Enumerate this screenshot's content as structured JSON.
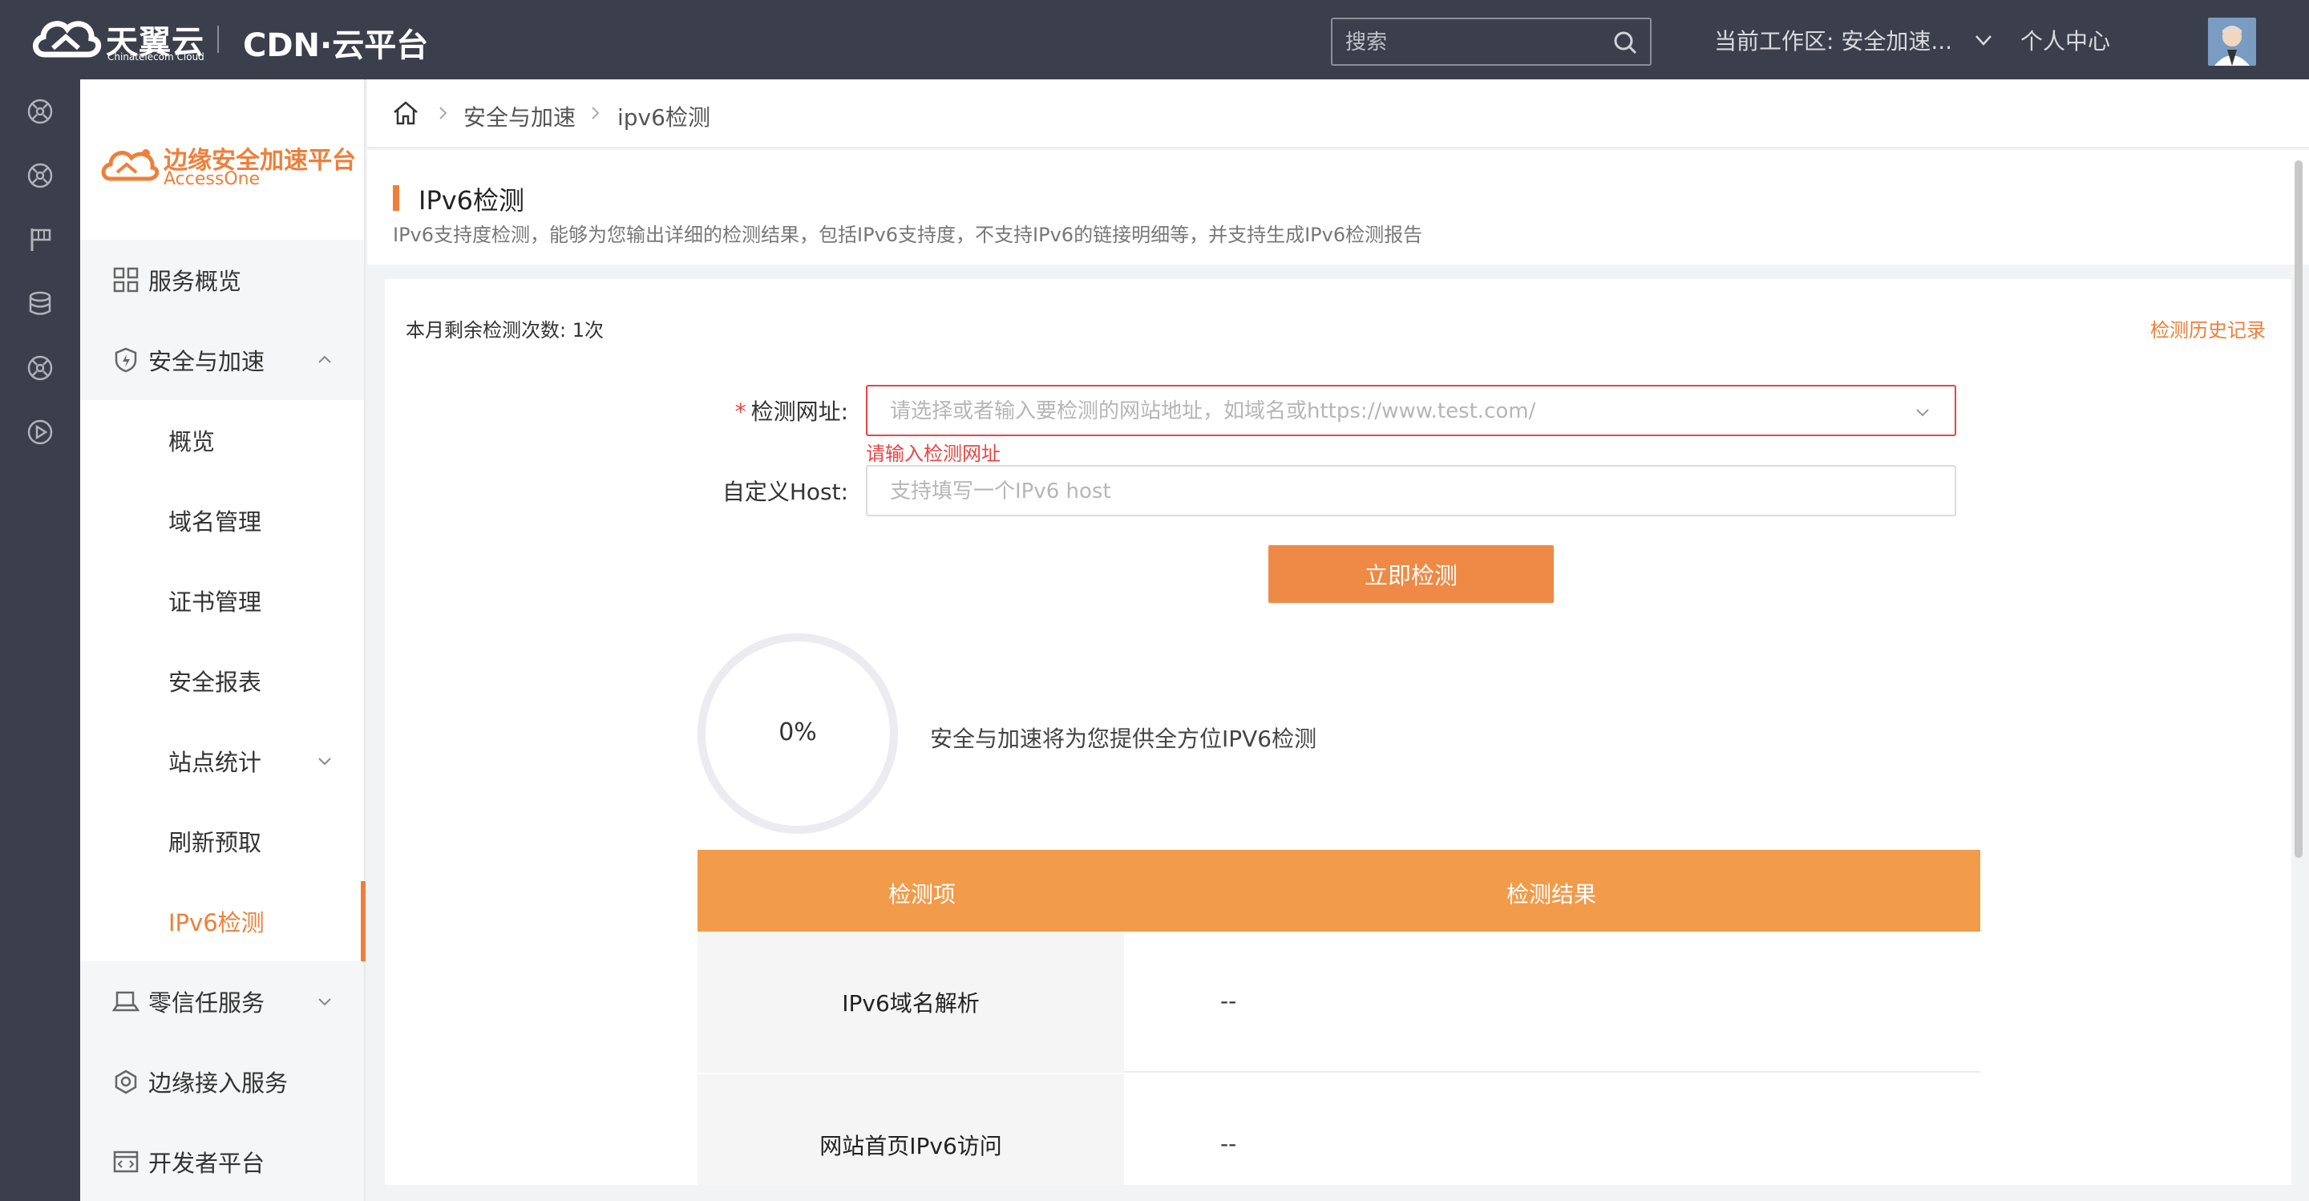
{
  "topbar": {
    "logo_text": "天翼云",
    "logo_sub": "Chinatelecom Cloud",
    "platform_name": "CDN·云平台",
    "search_placeholder": "搜索",
    "workspace_label": "当前工作区: 安全加速...",
    "personal_center": "个人中心"
  },
  "brand": {
    "title": "边缘安全加速平台",
    "subtitle": "AccessOne",
    "color": "#ee7f3a"
  },
  "sidebar": {
    "items": [
      {
        "label": "服务概览",
        "icon": "grid-icon"
      },
      {
        "label": "安全与加速",
        "icon": "shield-icon",
        "expanded": true
      },
      {
        "label": "概览"
      },
      {
        "label": "域名管理"
      },
      {
        "label": "证书管理"
      },
      {
        "label": "安全报表"
      },
      {
        "label": "站点统计",
        "has_children": true
      },
      {
        "label": "刷新预取"
      },
      {
        "label": "IPv6检测",
        "active": true
      },
      {
        "label": "零信任服务",
        "icon": "laptop-icon",
        "has_children": true
      },
      {
        "label": "边缘接入服务",
        "icon": "network-icon"
      },
      {
        "label": "开发者平台",
        "icon": "code-window-icon"
      }
    ]
  },
  "breadcrumb": {
    "items": [
      "安全与加速",
      "ipv6检测"
    ]
  },
  "page": {
    "title": "IPv6检测",
    "description": "IPv6支持度检测，能够为您输出详细的检测结果，包括IPv6支持度，不支持IPv6的链接明细等，并支持生成IPv6检测报告"
  },
  "card": {
    "remaining": "本月剩余检测次数:   1次",
    "history_link": "检测历史记录"
  },
  "form": {
    "url_label": "检测网址:",
    "url_required_mark": "*",
    "url_placeholder": "请选择或者输入要检测的网站地址，如域名或https://www.test.com/",
    "url_error": "请输入检测网址",
    "host_label": "自定义Host:",
    "host_placeholder": "支持填写一个IPv6 host",
    "submit_label": "立即检测"
  },
  "progress": {
    "value": 0,
    "text": "0%",
    "description": "安全与加速将为您提供全方位IPV6检测"
  },
  "results": {
    "headers": [
      "检测项",
      "检测结果"
    ],
    "rows": [
      {
        "item": "IPv6域名解析",
        "result": "--"
      },
      {
        "item": "网站首页IPv6访问",
        "result": "--"
      }
    ]
  },
  "colors": {
    "topbar_bg": "#3b3f4c",
    "accent": "#ee7f3a",
    "table_header": "#f29b4b",
    "error": "#e64545"
  }
}
